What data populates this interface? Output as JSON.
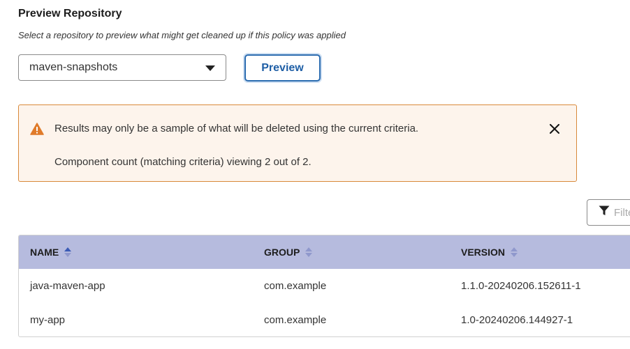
{
  "section": {
    "title": "Preview Repository",
    "description": "Select a repository to preview what might get cleaned up if this policy was applied"
  },
  "repository_select": {
    "selected": "maven-snapshots"
  },
  "preview_button": {
    "label": "Preview"
  },
  "alert": {
    "message": "Results may only be a sample of what will be deleted using the current criteria.",
    "count_text": "Component count (matching criteria) viewing 2 out of 2.",
    "icon": "warning-triangle-icon",
    "accent_color": "#e07b2a"
  },
  "filter": {
    "placeholder": "Filter",
    "icon": "filter-funnel-icon"
  },
  "table": {
    "columns": [
      {
        "label": "NAME",
        "sort": "ascending"
      },
      {
        "label": "GROUP",
        "sort": "none"
      },
      {
        "label": "VERSION",
        "sort": "none"
      }
    ],
    "rows": [
      {
        "name": "java-maven-app",
        "group": "com.example",
        "version": "1.1.0-20240206.152611-1"
      },
      {
        "name": "my-app",
        "group": "com.example",
        "version": "1.0-20240206.144927-1"
      }
    ],
    "header_color": "#b6bbde",
    "sort_active_color": "#3b5bb5"
  }
}
